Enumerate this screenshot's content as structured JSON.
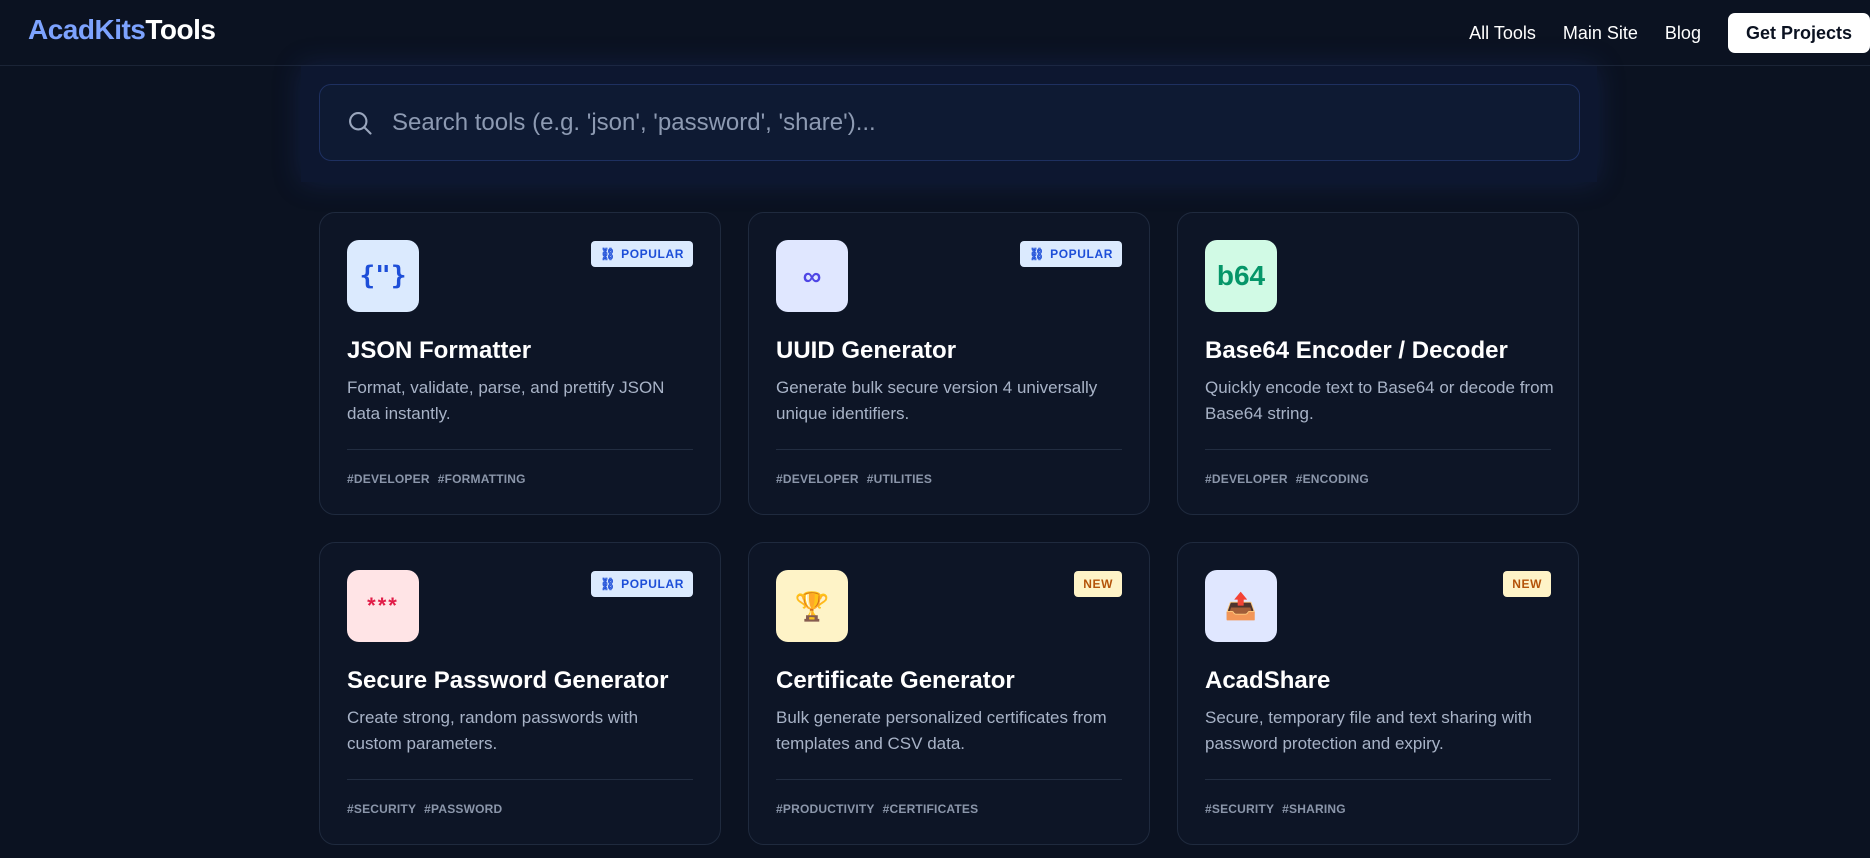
{
  "brand": {
    "part1": "AcadKits",
    "part2": "Tools"
  },
  "nav": {
    "links": [
      "All Tools",
      "Main Site",
      "Blog"
    ],
    "cta": "Get Projects"
  },
  "search": {
    "placeholder": "Search tools (e.g. 'json', 'password', 'share')..."
  },
  "colors": {
    "background": "#0b1221",
    "brand_accent": "#7da3ff",
    "popular_badge": "#dbeafe",
    "new_badge": "#fef3c7"
  },
  "cards": [
    {
      "icon_text": "{\"}",
      "icon_name": "braces-icon",
      "badge": "POPULAR",
      "title": "JSON Formatter",
      "description": "Format, validate, parse, and prettify JSON data instantly.",
      "tags": [
        "#DEVELOPER",
        "#FORMATTING"
      ]
    },
    {
      "icon_text": "∞",
      "icon_name": "infinity-icon",
      "badge": "POPULAR",
      "title": "UUID Generator",
      "description": "Generate bulk secure version 4 universally unique identifiers.",
      "tags": [
        "#DEVELOPER",
        "#UTILITIES"
      ]
    },
    {
      "icon_text": "b64",
      "icon_name": "b64-icon",
      "badge": "",
      "title": "Base64 Encoder / Decoder",
      "description": "Quickly encode text to Base64 or decode from Base64 string.",
      "tags": [
        "#DEVELOPER",
        "#ENCODING"
      ]
    },
    {
      "icon_text": "***",
      "icon_name": "password-icon",
      "badge": "POPULAR",
      "title": "Secure Password Generator",
      "description": "Create strong, random passwords with custom parameters.",
      "tags": [
        "#SECURITY",
        "#PASSWORD"
      ]
    },
    {
      "icon_text": "🏆",
      "icon_name": "trophy-icon",
      "badge": "NEW",
      "title": "Certificate Generator",
      "description": "Bulk generate personalized certificates from templates and CSV data.",
      "tags": [
        "#PRODUCTIVITY",
        "#CERTIFICATES"
      ]
    },
    {
      "icon_text": "📤",
      "icon_name": "share-upload-icon",
      "badge": "NEW",
      "title": "AcadShare",
      "description": "Secure, temporary file and text sharing with password protection and expiry.",
      "tags": [
        "#SECURITY",
        "#SHARING"
      ]
    }
  ]
}
